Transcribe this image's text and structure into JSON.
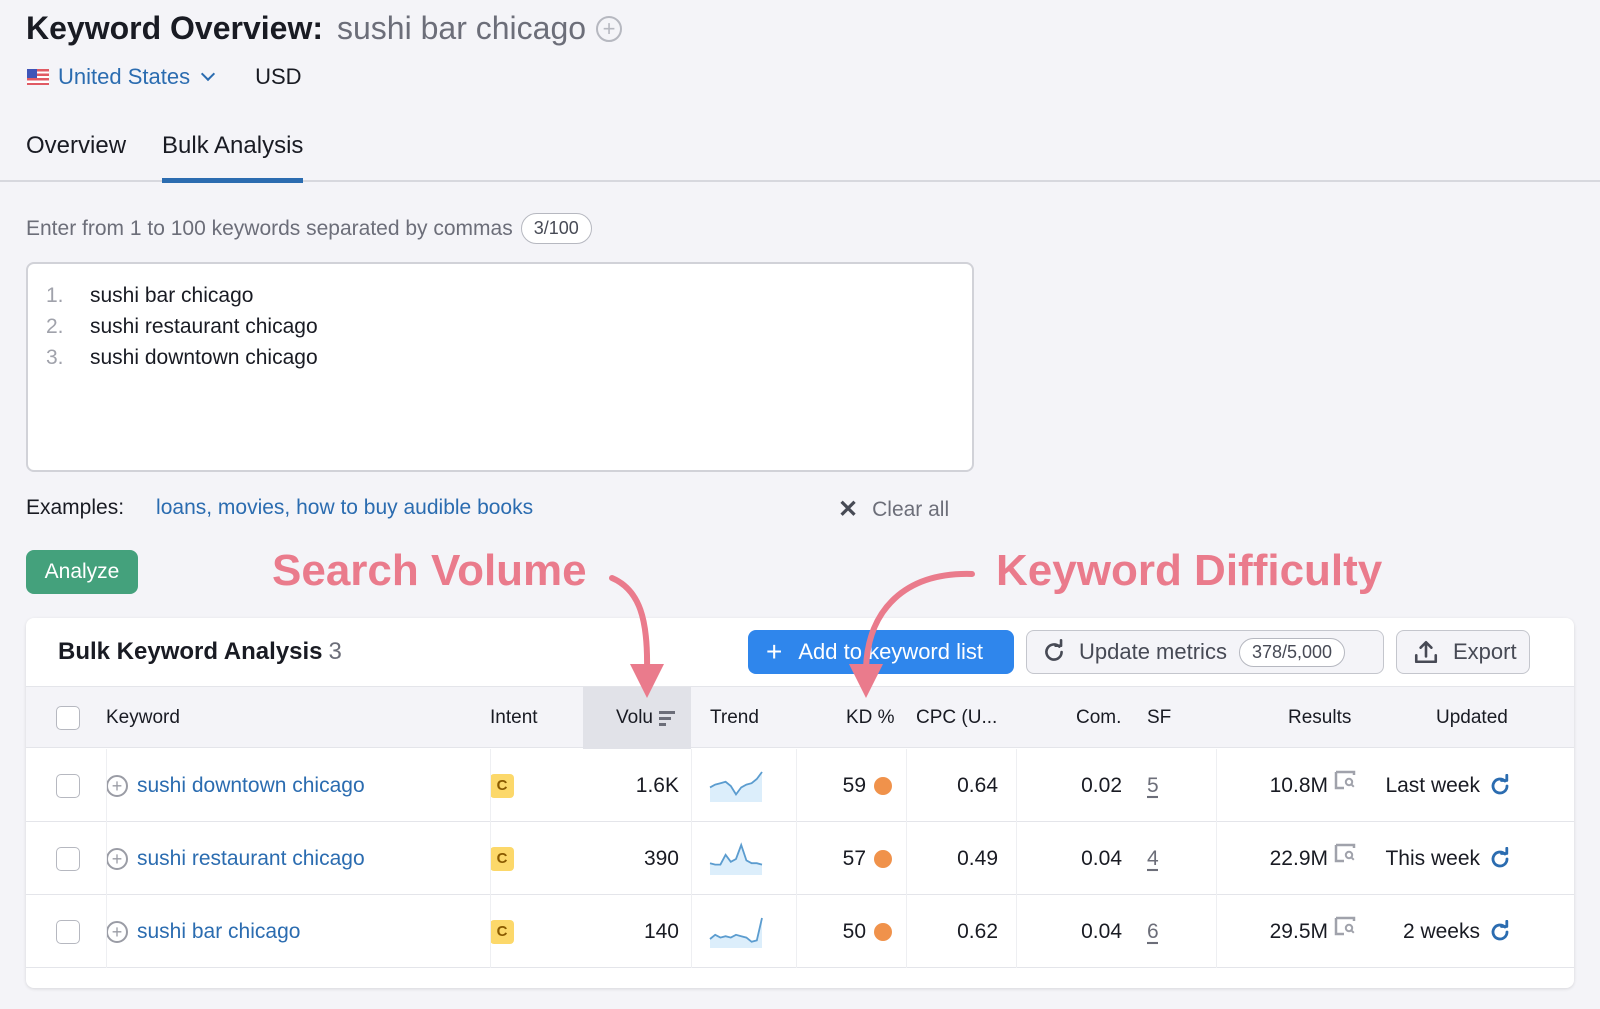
{
  "header": {
    "title": "Keyword Overview:",
    "keyword": "sushi bar chicago",
    "database": "United States",
    "currency": "USD"
  },
  "tabs": [
    {
      "label": "Overview",
      "active": false
    },
    {
      "label": "Bulk Analysis",
      "active": true
    }
  ],
  "input": {
    "hint": "Enter from 1 to 100 keywords separated by commas",
    "counter": "3/100",
    "keywords": [
      {
        "num": "1.",
        "text": "sushi bar chicago"
      },
      {
        "num": "2.",
        "text": "sushi restaurant chicago"
      },
      {
        "num": "3.",
        "text": "sushi downtown chicago"
      }
    ],
    "examples_label": "Examples:",
    "examples_links": "loans, movies, how to buy audible books",
    "clear_all": "Clear all",
    "analyze_label": "Analyze"
  },
  "annotations": {
    "search_volume": "Search Volume",
    "keyword_difficulty": "Keyword Difficulty",
    "color": "#ea7b8c"
  },
  "table": {
    "title": "Bulk Keyword Analysis",
    "count": "3",
    "add_to_list": "Add to keyword list",
    "update_metrics": "Update metrics",
    "update_quota": "378/5,000",
    "export": "Export",
    "columns": {
      "keyword": "Keyword",
      "intent": "Intent",
      "volume": "Volu",
      "trend": "Trend",
      "kd": "KD %",
      "cpc": "CPC (U...",
      "com": "Com.",
      "sf": "SF",
      "results": "Results",
      "updated": "Updated"
    },
    "rows": [
      {
        "keyword": "sushi downtown chicago",
        "intent": "C",
        "volume": "1.6K",
        "trend": [
          0.45,
          0.55,
          0.6,
          0.65,
          0.5,
          0.2,
          0.45,
          0.55,
          0.6,
          0.75,
          1.0
        ],
        "kd": "59",
        "kd_color": "#f0924b",
        "cpc": "0.64",
        "com": "0.02",
        "sf": "5",
        "results": "10.8M",
        "updated": "Last week"
      },
      {
        "keyword": "sushi restaurant chicago",
        "intent": "C",
        "volume": "390",
        "trend": [
          0.35,
          0.3,
          0.3,
          0.65,
          0.4,
          0.5,
          1.0,
          0.45,
          0.35,
          0.35,
          0.3
        ],
        "kd": "57",
        "kd_color": "#f0924b",
        "cpc": "0.49",
        "com": "0.04",
        "sf": "4",
        "results": "22.9M",
        "updated": "This week"
      },
      {
        "keyword": "sushi bar chicago",
        "intent": "C",
        "volume": "140",
        "trend": [
          0.25,
          0.4,
          0.3,
          0.35,
          0.3,
          0.4,
          0.35,
          0.3,
          0.15,
          0.2,
          1.0
        ],
        "kd": "50",
        "kd_color": "#f0924b",
        "cpc": "0.62",
        "com": "0.04",
        "sf": "6",
        "results": "29.5M",
        "updated": "2 weeks"
      }
    ]
  }
}
